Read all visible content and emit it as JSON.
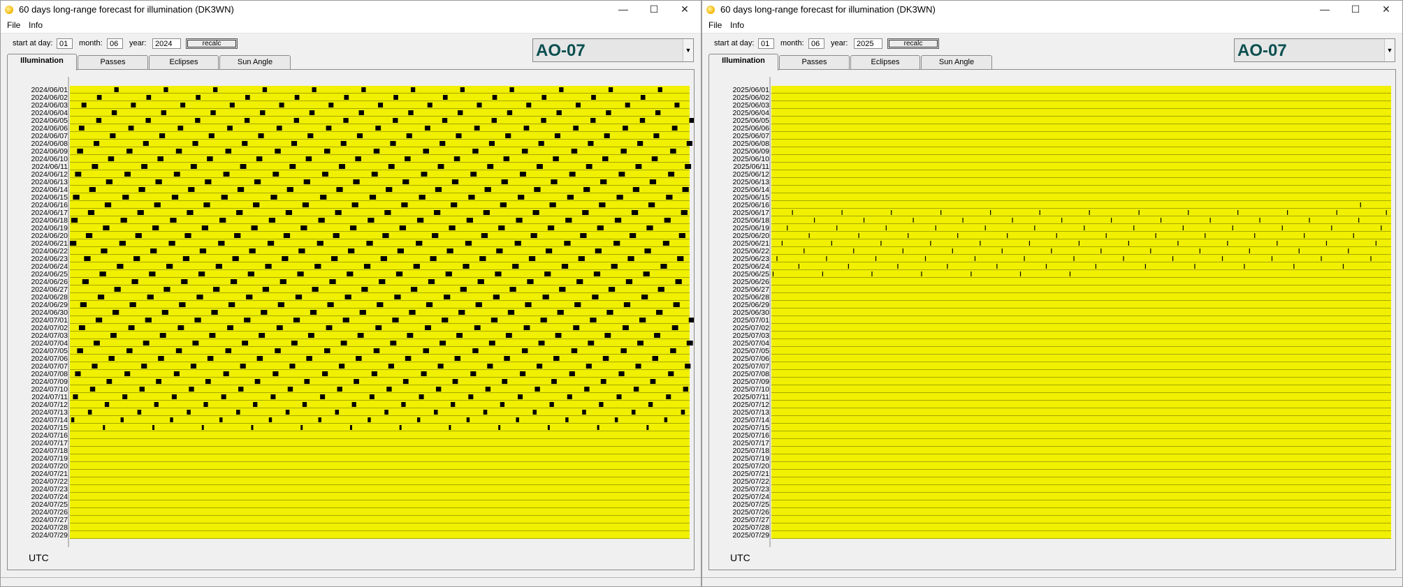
{
  "windows": [
    {
      "title": "60 days long-range forecast for illumination (DK3WN)",
      "controls": {
        "minimize": "—",
        "maximize": "☐",
        "close": "✕"
      },
      "menu": [
        "File",
        "Info"
      ],
      "form": {
        "day_label": "start at day:",
        "day": "01",
        "month_label": "month:",
        "month": "06",
        "year_label": "year:",
        "year": "2024",
        "recalc_label": "recalc"
      },
      "satellite": "AO-07",
      "tabs": [
        "Illumination",
        "Passes",
        "Eclipses",
        "Sun Angle"
      ],
      "active_tab": "Illumination",
      "utc_label": "UTC",
      "chart_data": {
        "type": "heatmap",
        "title": "",
        "xlabel": "UTC",
        "ylabel": "",
        "colors": {
          "illuminated": "#f0f000",
          "eclipse": "#000000",
          "row_separator": "#a8a800"
        },
        "dates": [
          "2024/06/01",
          "2024/06/02",
          "2024/06/03",
          "2024/06/04",
          "2024/06/05",
          "2024/06/06",
          "2024/06/07",
          "2024/06/08",
          "2024/06/09",
          "2024/06/10",
          "2024/06/11",
          "2024/06/12",
          "2024/06/13",
          "2024/06/14",
          "2024/06/15",
          "2024/06/16",
          "2024/06/17",
          "2024/06/18",
          "2024/06/19",
          "2024/06/20",
          "2024/06/21",
          "2024/06/22",
          "2024/06/23",
          "2024/06/24",
          "2024/06/25",
          "2024/06/26",
          "2024/06/27",
          "2024/06/28",
          "2024/06/29",
          "2024/06/30",
          "2024/07/01",
          "2024/07/02",
          "2024/07/03",
          "2024/07/04",
          "2024/07/05",
          "2024/07/06",
          "2024/07/07",
          "2024/07/08",
          "2024/07/09",
          "2024/07/10",
          "2024/07/11",
          "2024/07/12",
          "2024/07/13",
          "2024/07/14",
          "2024/07/15",
          "2024/07/16",
          "2024/07/17",
          "2024/07/18",
          "2024/07/19",
          "2024/07/20",
          "2024/07/21",
          "2024/07/22",
          "2024/07/23",
          "2024/07/24",
          "2024/07/25",
          "2024/07/26",
          "2024/07/27",
          "2024/07/28",
          "2024/07/29"
        ],
        "eclipse_pattern": {
          "orbits_per_day": 12.54,
          "first_eclipse_start_utc_hours": [
            1.72,
            1.05,
            0.45,
            1.62,
            1.02,
            0.35,
            1.55,
            0.92,
            0.28,
            1.48,
            0.85,
            0.2,
            1.4,
            0.75,
            0.12,
            1.35,
            0.7,
            0.05,
            1.28,
            0.62,
            0.0,
            1.2,
            0.55,
            1.82,
            1.15,
            0.48,
            1.72,
            1.08,
            0.4,
            1.65,
            1.0,
            0.35,
            1.57,
            0.92,
            0.28,
            1.5,
            0.85,
            0.2,
            1.42,
            0.78,
            0.12,
            1.35,
            0.7,
            0.05,
            1.28
          ],
          "eclipse_duration_hours": [
            0.17,
            0.18,
            0.19,
            0.2,
            0.2,
            0.21,
            0.22,
            0.22,
            0.23,
            0.23,
            0.24,
            0.24,
            0.25,
            0.25,
            0.25,
            0.25,
            0.25,
            0.25,
            0.25,
            0.25,
            0.25,
            0.25,
            0.25,
            0.25,
            0.25,
            0.25,
            0.25,
            0.25,
            0.25,
            0.25,
            0.25,
            0.24,
            0.24,
            0.24,
            0.23,
            0.23,
            0.22,
            0.22,
            0.21,
            0.2,
            0.19,
            0.17,
            0.15,
            0.12,
            0.08
          ],
          "last_eclipse_row": "2024/07/16"
        }
      }
    },
    {
      "title": "60 days long-range forecast for illumination (DK3WN)",
      "controls": {
        "minimize": "—",
        "maximize": "☐",
        "close": "✕"
      },
      "menu": [
        "File",
        "Info"
      ],
      "form": {
        "day_label": "start at day:",
        "day": "01",
        "month_label": "month:",
        "month": "06",
        "year_label": "year:",
        "year": "2025",
        "recalc_label": "recalc"
      },
      "satellite": "AO-07",
      "tabs": [
        "Illumination",
        "Passes",
        "Eclipses",
        "Sun Angle"
      ],
      "active_tab": "Illumination",
      "utc_label": "UTC",
      "chart_data": {
        "type": "heatmap",
        "title": "",
        "xlabel": "UTC",
        "ylabel": "",
        "colors": {
          "illuminated": "#f0f000",
          "eclipse": "#000000",
          "row_separator": "#a8a800"
        },
        "dates": [
          "2025/06/01",
          "2025/06/02",
          "2025/06/03",
          "2025/06/04",
          "2025/06/05",
          "2025/06/06",
          "2025/06/07",
          "2025/06/08",
          "2025/06/09",
          "2025/06/10",
          "2025/06/11",
          "2025/06/12",
          "2025/06/13",
          "2025/06/14",
          "2025/06/15",
          "2025/06/16",
          "2025/06/17",
          "2025/06/18",
          "2025/06/19",
          "2025/06/20",
          "2025/06/21",
          "2025/06/22",
          "2025/06/23",
          "2025/06/24",
          "2025/06/25",
          "2025/06/26",
          "2025/06/27",
          "2025/06/28",
          "2025/06/29",
          "2025/06/30",
          "2025/07/01",
          "2025/07/02",
          "2025/07/03",
          "2025/07/04",
          "2025/07/05",
          "2025/07/06",
          "2025/07/07",
          "2025/07/08",
          "2025/07/09",
          "2025/07/10",
          "2025/07/11",
          "2025/07/12",
          "2025/07/13",
          "2025/07/14",
          "2025/07/15",
          "2025/07/16",
          "2025/07/17",
          "2025/07/18",
          "2025/07/19",
          "2025/07/20",
          "2025/07/21",
          "2025/07/22",
          "2025/07/23",
          "2025/07/24",
          "2025/07/25",
          "2025/07/26",
          "2025/07/27",
          "2025/07/28",
          "2025/07/29"
        ],
        "eclipse_rows": [
          {
            "date": "2025/06/16",
            "starts_utc_hours": [
              22.8
            ],
            "duration_hours": 0.02
          },
          {
            "date": "2025/06/17",
            "starts_utc_hours": [
              0.8,
              2.72,
              4.63,
              6.55,
              8.47,
              10.38,
              12.3,
              14.22,
              16.13,
              18.05,
              19.97,
              21.88,
              23.8
            ],
            "duration_hours": 0.03
          },
          {
            "date": "2025/06/18",
            "starts_utc_hours": [
              1.65,
              3.57,
              5.48,
              7.4,
              9.32,
              11.23,
              13.15,
              15.07,
              16.98,
              18.9,
              20.82,
              22.73
            ],
            "duration_hours": 0.03
          },
          {
            "date": "2025/06/19",
            "starts_utc_hours": [
              0.6,
              2.52,
              4.43,
              6.35,
              8.27,
              10.18,
              12.1,
              14.02,
              15.93,
              17.85,
              19.77,
              21.68,
              23.6
            ],
            "duration_hours": 0.03
          },
          {
            "date": "2025/06/20",
            "starts_utc_hours": [
              1.45,
              3.37,
              5.28,
              7.2,
              9.12,
              11.03,
              12.95,
              14.87,
              16.78,
              18.7,
              20.62,
              22.53
            ],
            "duration_hours": 0.03
          },
          {
            "date": "2025/06/21",
            "starts_utc_hours": [
              0.4,
              2.32,
              4.23,
              6.15,
              8.07,
              9.98,
              11.9,
              13.82,
              15.73,
              17.65,
              19.57,
              21.48,
              23.4
            ],
            "duration_hours": 0.03
          },
          {
            "date": "2025/06/22",
            "starts_utc_hours": [
              1.25,
              3.17,
              5.08,
              7.0,
              8.92,
              10.83,
              12.75,
              14.67,
              16.58,
              18.5,
              20.42,
              22.33
            ],
            "duration_hours": 0.03
          },
          {
            "date": "2025/06/23",
            "starts_utc_hours": [
              0.2,
              2.12,
              4.03,
              5.95,
              7.87,
              9.78,
              11.7,
              13.62,
              15.53,
              17.45,
              19.37,
              21.28,
              23.2
            ],
            "duration_hours": 0.03
          },
          {
            "date": "2025/06/24",
            "starts_utc_hours": [
              1.05,
              2.97,
              4.88,
              6.8,
              8.72,
              10.63,
              12.55,
              14.47,
              16.38,
              18.3,
              20.22,
              22.13
            ],
            "duration_hours": 0.03
          },
          {
            "date": "2025/06/25",
            "starts_utc_hours": [
              0.05,
              1.97,
              3.88,
              5.8,
              7.72,
              9.63,
              11.55
            ],
            "duration_hours": 0.03
          }
        ]
      }
    }
  ]
}
